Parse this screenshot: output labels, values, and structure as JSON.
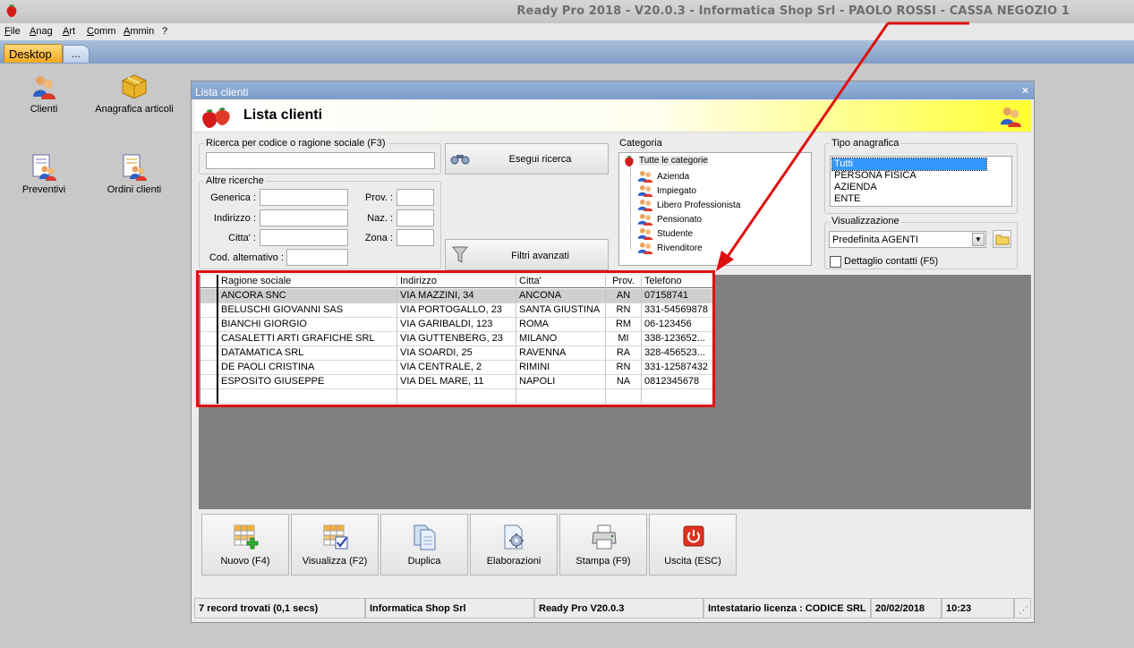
{
  "app": {
    "title": "Ready Pro 2018 - V20.0.3 - Informatica Shop Srl - PAOLO ROSSI - CASSA NEGOZIO 1"
  },
  "menu": [
    "File",
    "Anag",
    "Art",
    "Comm",
    "Ammin",
    "?"
  ],
  "tabs": {
    "desktop": "Desktop",
    "more": "..."
  },
  "desktop_icons": [
    {
      "label": "Clienti",
      "icon": "people-icon"
    },
    {
      "label": "Anagrafica articoli",
      "icon": "box-icon"
    },
    {
      "label": "Preventivi",
      "icon": "document-people-icon"
    },
    {
      "label": "Ordini clienti",
      "icon": "document-people-icon"
    }
  ],
  "window": {
    "title": "Lista clienti",
    "close": "×",
    "header_title": "Lista clienti"
  },
  "search": {
    "legend": "Ricerca per codice o ragione sociale (F3)",
    "value": "",
    "run_button": "Esegui ricerca",
    "advanced_button": "Filtri avanzati"
  },
  "other_search": {
    "legend": "Altre ricerche",
    "generica": "Generica :",
    "prov": "Prov. :",
    "indirizzo": "Indirizzo :",
    "naz": "Naz. :",
    "citta": "Citta' :",
    "zona": "Zona :",
    "cod_alternativo": "Cod. alternativo :"
  },
  "categoria": {
    "legend": "Categoria",
    "root": "Tutte le categorie",
    "items": [
      "Azienda",
      "Impiegato",
      "Libero Professionista",
      "Pensionato",
      "Studente",
      "Rivenditore"
    ]
  },
  "tipo_anagrafica": {
    "legend": "Tipo anagrafica",
    "items": [
      "Tutti",
      "PERSONA FISICA",
      "AZIENDA",
      "ENTE"
    ],
    "selected": "Tutti"
  },
  "visualizzazione": {
    "legend": "Visualizzazione",
    "selected": "Predefinita AGENTI",
    "dettaglio_label": "Dettaglio contatti (F5)",
    "dettaglio_checked": false
  },
  "table": {
    "columns": [
      "Ragione sociale",
      "Indirizzo",
      "Citta'",
      "Prov.",
      "Telefono"
    ],
    "rows": [
      [
        "ANCORA SNC",
        "VIA MAZZINI, 34",
        "ANCONA",
        "AN",
        "07158741"
      ],
      [
        "BELUSCHI GIOVANNI SAS",
        "VIA PORTOGALLO, 23",
        "SANTA GIUSTINA",
        "RN",
        "331-54569878"
      ],
      [
        "BIANCHI GIORGIO",
        "VIA GARIBALDI, 123",
        "ROMA",
        "RM",
        "06-123456"
      ],
      [
        "CASALETTI ARTI GRAFICHE SRL",
        "VIA GUTTENBERG, 23",
        "MILANO",
        "MI",
        "338-123652..."
      ],
      [
        "DATAMATICA SRL",
        "VIA SOARDI, 25",
        "RAVENNA",
        "RA",
        "328-456523..."
      ],
      [
        "DE PAOLI CRISTINA",
        "VIA CENTRALE, 2",
        "RIMINI",
        "RN",
        "331-12587432"
      ],
      [
        "ESPOSITO GIUSEPPE",
        "VIA DEL MARE, 11",
        "NAPOLI",
        "NA",
        "0812345678"
      ]
    ]
  },
  "toolbar": {
    "nuovo": "Nuovo (F4)",
    "visualizza": "Visualizza (F2)",
    "duplica": "Duplica",
    "elaborazioni": "Elaborazioni",
    "stampa": "Stampa (F9)",
    "uscita": "Uscita (ESC)"
  },
  "status": {
    "records": "7 record trovati (0,1 secs)",
    "company": "Informatica Shop Srl",
    "version": "Ready Pro V20.0.3",
    "license": "Intestatario licenza : CODICE SRL",
    "date": "20/02/2018",
    "time": "10:23"
  },
  "colors": {
    "highlight": "#e01010",
    "tab_active": "#f2a81f",
    "header_gradient_end": "#ffff33",
    "selection": "#3399ff"
  }
}
